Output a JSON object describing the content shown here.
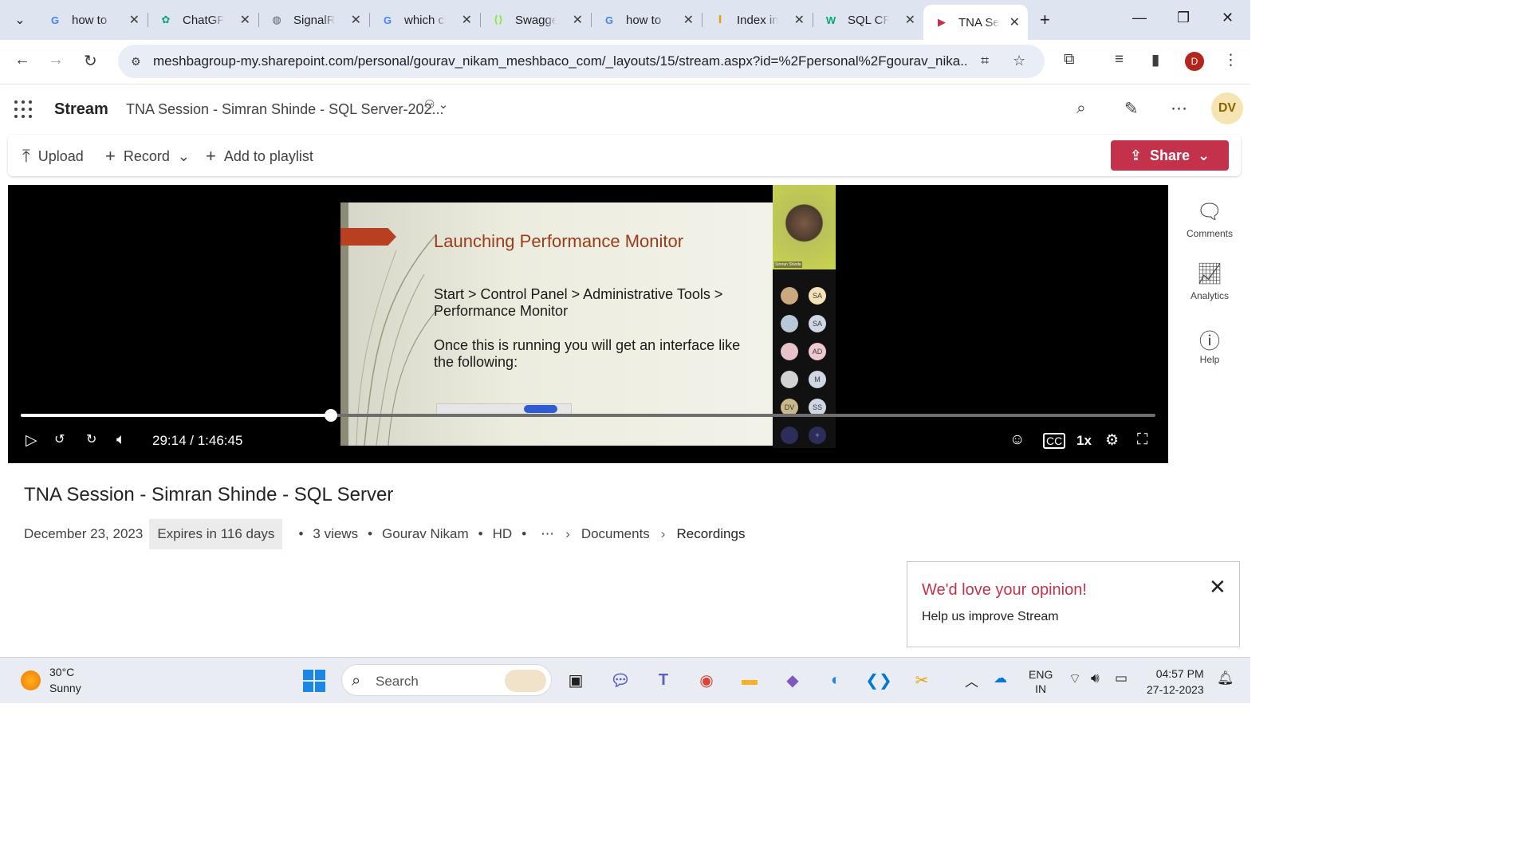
{
  "browser": {
    "tabs": [
      {
        "title": "how to",
        "favicon": "google-icon",
        "color": "#4285f4"
      },
      {
        "title": "ChatGPT",
        "favicon": "chatgpt-icon",
        "color": "#10a37f"
      },
      {
        "title": "SignalR",
        "favicon": "globe-icon",
        "color": "#5f6368"
      },
      {
        "title": "which cl",
        "favicon": "google-icon",
        "color": "#4285f4"
      },
      {
        "title": "Swagger",
        "favicon": "swagger-icon",
        "color": "#85ea2d"
      },
      {
        "title": "how to",
        "favicon": "google-icon",
        "color": "#4285f4"
      },
      {
        "title": "Index in",
        "favicon": "index-icon",
        "color": "#e8a200"
      },
      {
        "title": "SQL CRU",
        "favicon": "w3schools-icon",
        "color": "#04aa6d"
      },
      {
        "title": "TNA Ses",
        "favicon": "stream-icon",
        "color": "#c4314b"
      }
    ],
    "url": "meshbagroup-my.sharepoint.com/personal/gourav_nikam_meshbaco_com/_layouts/15/stream.aspx?id=%2Fpersonal%2Fgourav_nika...",
    "profile_initial": "D"
  },
  "stream": {
    "app_name": "Stream",
    "doc_title": "TNA Session - Simran Shinde - SQL Server-202...",
    "avatar": "DV"
  },
  "commands": {
    "upload": "Upload",
    "record": "Record",
    "add_to_playlist": "Add to playlist",
    "share": "Share"
  },
  "slide": {
    "title": "Launching Performance Monitor",
    "line1": "Start > Control Panel > Administrative Tools >",
    "line2": "Performance Monitor",
    "line3": "Once this is running you will get an interface like",
    "line4": "the following:",
    "speaker": "Simran Shinde"
  },
  "gallery": [
    {
      "a": "",
      "b": "SA"
    },
    {
      "a": "",
      "b": "SA"
    },
    {
      "a": "",
      "b": "AD"
    },
    {
      "a": "",
      "b": "M"
    },
    {
      "a": "DV",
      "b": "SS"
    },
    {
      "a": "",
      "b": "+"
    }
  ],
  "player": {
    "time": "29:14 / 1:46:45",
    "progress": 0.2735,
    "speed": "1x"
  },
  "rail": {
    "comments": "Comments",
    "analytics": "Analytics",
    "help": "Help"
  },
  "video": {
    "title": "TNA Session - Simran Shinde - SQL Server",
    "date": "December 23, 2023",
    "expires": "Expires in 116 days",
    "views": "3 views",
    "owner": "Gourav Nikam",
    "quality": "HD",
    "crumb_documents": "Documents",
    "crumb_recordings": "Recordings"
  },
  "feedback": {
    "title": "We'd love your opinion!",
    "text": "Help us improve Stream"
  },
  "taskbar": {
    "temp": "30°C",
    "weather": "Sunny",
    "search": "Search",
    "lang1": "ENG",
    "lang2": "IN",
    "time": "04:57 PM",
    "date": "27-12-2023"
  }
}
